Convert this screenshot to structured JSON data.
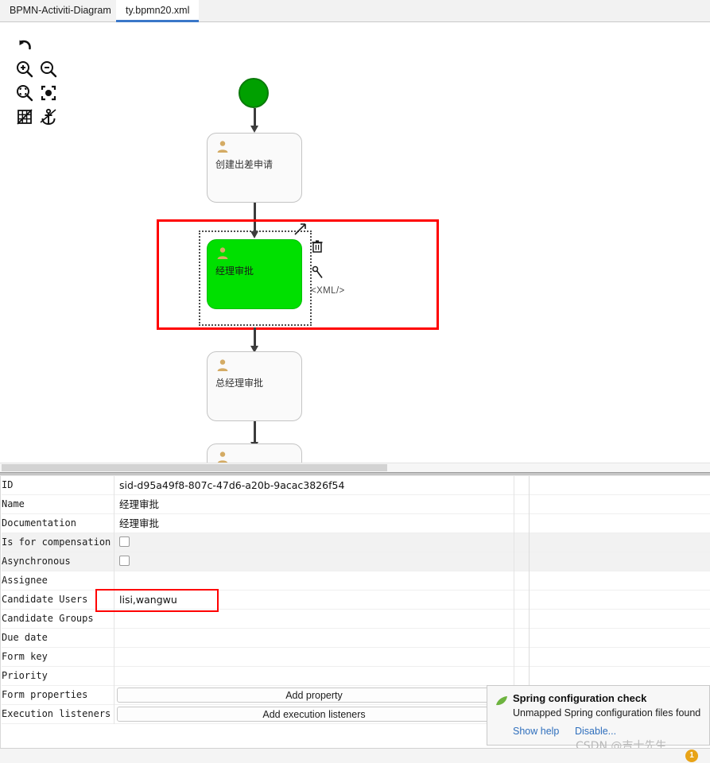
{
  "tabs": [
    {
      "label": "BPMN-Activiti-Diagram",
      "active": false
    },
    {
      "label": "ty.bpmn20.xml",
      "active": true
    }
  ],
  "toolbar": {
    "icons": [
      {
        "name": "undo-icon",
        "title": "Undo"
      },
      {
        "name": "zoom-in-icon",
        "title": "Zoom In"
      },
      {
        "name": "zoom-out-icon",
        "title": "Zoom Out"
      },
      {
        "name": "zoom-fit-icon",
        "title": "Zoom to Fit"
      },
      {
        "name": "zoom-actual-icon",
        "title": "Actual Size"
      },
      {
        "name": "grid-off-icon",
        "title": "Toggle Grid"
      },
      {
        "name": "anchor-icon",
        "title": "Toggle Anchors"
      }
    ]
  },
  "diagram": {
    "start_event": {
      "name": "start-event",
      "color": "#00a000"
    },
    "tasks": [
      {
        "label": "创建出差申请",
        "selected": false
      },
      {
        "label": "经理审批",
        "selected": true
      },
      {
        "label": "总经理审批",
        "selected": false
      },
      {
        "label": "",
        "selected": false
      }
    ],
    "context_actions": [
      {
        "name": "create-connection-icon",
        "label": ""
      },
      {
        "name": "delete-icon",
        "label": ""
      },
      {
        "name": "morph-icon",
        "label": ""
      },
      {
        "name": "xml-icon",
        "label": "<XML/>"
      }
    ],
    "annotation_color": "#ff0000",
    "selected_fill": "#00e000"
  },
  "properties": {
    "rows": [
      {
        "label": "ID",
        "type": "text",
        "value": "sid-d95a49f8-807c-47d6-a20b-9acac3826f54",
        "shaded": false
      },
      {
        "label": "Name",
        "type": "text",
        "value": "经理审批",
        "shaded": false
      },
      {
        "label": "Documentation",
        "type": "text",
        "value": "经理审批",
        "shaded": false
      },
      {
        "label": "Is for compensation",
        "type": "checkbox",
        "value": "",
        "checked": false,
        "shaded": true
      },
      {
        "label": "Asynchronous",
        "type": "checkbox",
        "value": "",
        "checked": false,
        "shaded": true
      },
      {
        "label": "Assignee",
        "type": "text",
        "value": "",
        "shaded": false
      },
      {
        "label": "Candidate Users",
        "type": "text",
        "value": "lisi,wangwu",
        "shaded": false,
        "highlighted": true
      },
      {
        "label": "Candidate Groups",
        "type": "text",
        "value": "",
        "shaded": false
      },
      {
        "label": "Due date",
        "type": "text",
        "value": "",
        "shaded": false
      },
      {
        "label": "Form key",
        "type": "text",
        "value": "",
        "shaded": false
      },
      {
        "label": "Priority",
        "type": "text",
        "value": "",
        "shaded": false
      },
      {
        "label": "Form properties",
        "type": "button",
        "value": "Add property",
        "shaded": false
      },
      {
        "label": "Execution listeners",
        "type": "button",
        "value": "Add execution listeners",
        "shaded": false
      }
    ]
  },
  "notification": {
    "icon": "spring-leaf-icon",
    "title": "Spring configuration check",
    "body": "Unmapped Spring configuration files found",
    "links": [
      {
        "label": "Show help"
      },
      {
        "label": "Disable..."
      }
    ]
  },
  "watermark": {
    "text": "CSDN @吉士先生"
  },
  "statusbar": {
    "badge_count": "1",
    "badge_color": "#e8a317"
  }
}
